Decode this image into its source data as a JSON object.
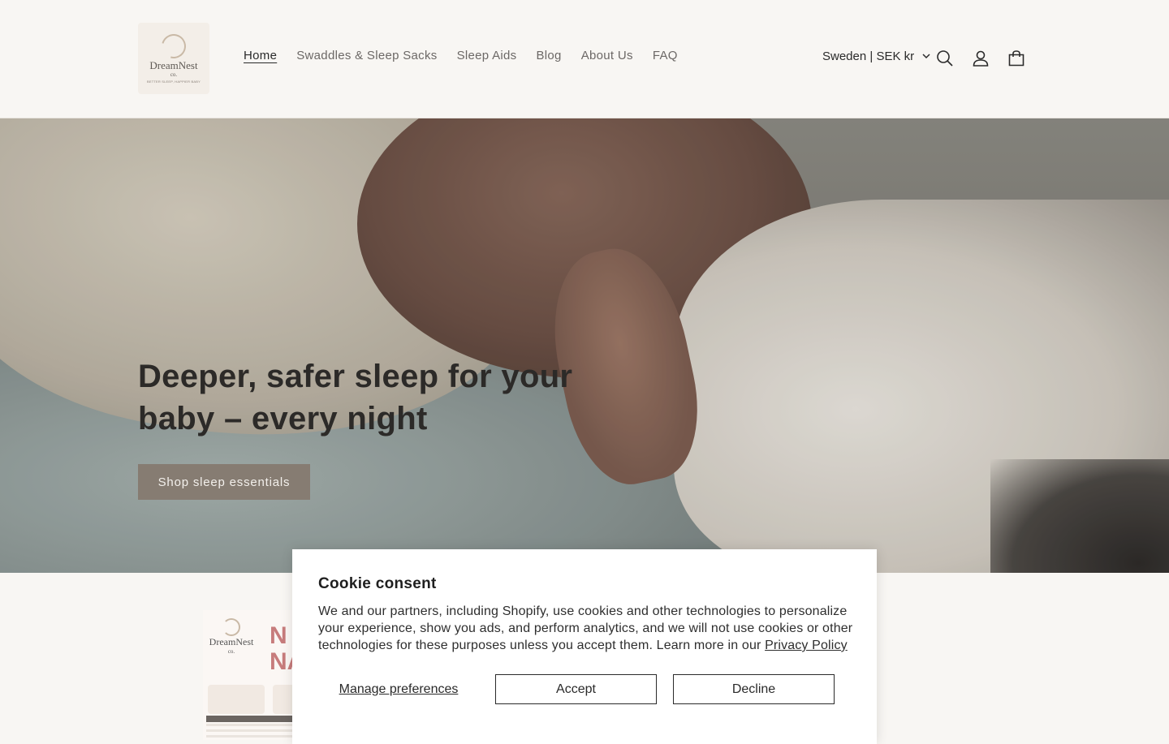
{
  "header": {
    "logo": {
      "name": "DreamNest",
      "suffix": "co.",
      "tagline": "BETTER SLEEP, HAPPIER BABY"
    },
    "nav": [
      {
        "label": "Home",
        "active": true
      },
      {
        "label": "Swaddles & Sleep Sacks",
        "active": false
      },
      {
        "label": "Sleep Aids",
        "active": false
      },
      {
        "label": "Blog",
        "active": false
      },
      {
        "label": "About Us",
        "active": false
      },
      {
        "label": "FAQ",
        "active": false
      }
    ],
    "locale": "Sweden | SEK kr",
    "icons": [
      "search-icon",
      "account-icon",
      "cart-icon"
    ]
  },
  "hero": {
    "title": "Deeper, safer sleep for your baby – every night",
    "cta": "Shop sleep essentials"
  },
  "product_preview": {
    "logo_name": "DreamNest",
    "logo_suffix": "co.",
    "big_text": "N\nNA"
  },
  "cookie": {
    "title": "Cookie consent",
    "text": "We and our partners, including Shopify, use cookies and other technologies to personalize your experience, show you ads, and perform analytics, and we will not use cookies or other technologies for these purposes unless you accept them. Learn more in our ",
    "link": "Privacy Policy",
    "manage": "Manage preferences",
    "accept": "Accept",
    "decline": "Decline"
  },
  "colors": {
    "background": "#f8f6f3",
    "cta": "#867c72",
    "text": "#2a2a2a"
  }
}
